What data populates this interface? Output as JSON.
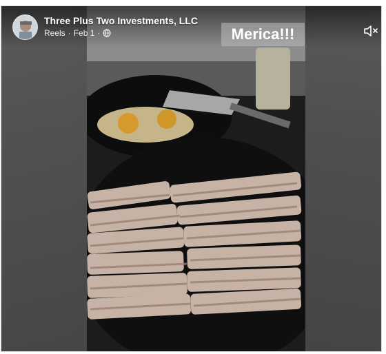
{
  "post": {
    "page_name": "Three Plus Two Investments, LLC",
    "section": "Reels",
    "separator": "·",
    "date": "Feb 1",
    "trailing_separator": "·",
    "privacy_icon": "globe-icon"
  },
  "video": {
    "caption_overlay": "Merica!!!",
    "mute_icon": "muted-speaker-icon"
  }
}
